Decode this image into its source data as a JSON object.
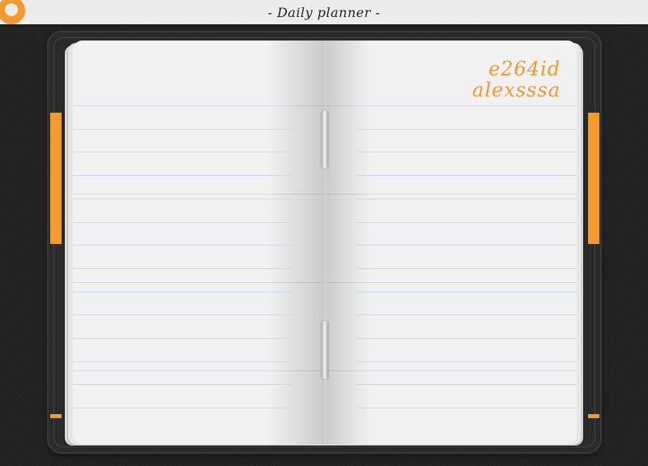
{
  "header": {
    "title": "- Daily planner -",
    "logo_icon": "planner-logo-icon"
  },
  "notebook": {
    "user_line1": "e264id",
    "user_line2": "alexsssa",
    "accent_color": "#f39a2c"
  }
}
